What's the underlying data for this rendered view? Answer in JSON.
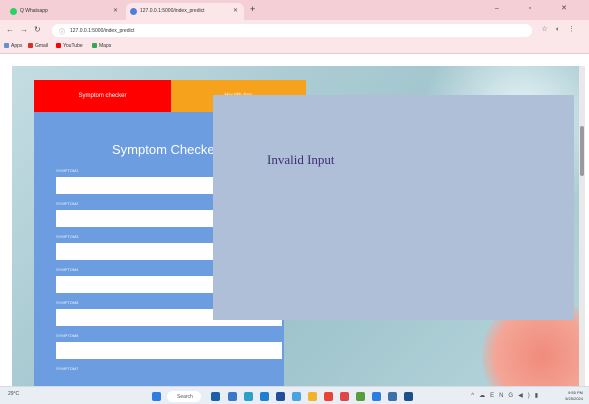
{
  "browser": {
    "tabs": [
      {
        "label": "Q Whatsapp"
      },
      {
        "label": "127.0.0.1:5000/index_predict"
      }
    ],
    "new_tab_label": "+",
    "window_controls": "–  ▫  ✕",
    "address_bar": {
      "value": "127.0.0.1:5000/index_predict"
    },
    "bookmarks": [
      {
        "label": "Apps"
      },
      {
        "label": "Gmail"
      },
      {
        "label": "YouTube"
      },
      {
        "label": "Maps"
      }
    ]
  },
  "page": {
    "tabs": [
      {
        "label": "Symptom checker"
      },
      {
        "label": "Health tips"
      }
    ],
    "form": {
      "title": "Symptom Checker",
      "fields": [
        {
          "label": "SYMPTOM1"
        },
        {
          "label": "SYMPTOM2"
        },
        {
          "label": "SYMPTOM3"
        },
        {
          "label": "SYMPTOM4"
        },
        {
          "label": "SYMPTOM5"
        },
        {
          "label": "SYMPTOM6"
        },
        {
          "label": "SYMPTOM7"
        }
      ]
    },
    "modal": {
      "message": "Invalid Input"
    }
  },
  "taskbar": {
    "weather": "29°C",
    "search_label": "Search",
    "clock_time": "9:55 PM",
    "clock_date": "5/25/2024"
  },
  "colors": {
    "tab_active": "#ff0000",
    "tab_inactive": "#f7a21c",
    "form_panel": "#6c9de0",
    "modal_bg": "#b0bfd8",
    "modal_text": "#3b3070"
  }
}
